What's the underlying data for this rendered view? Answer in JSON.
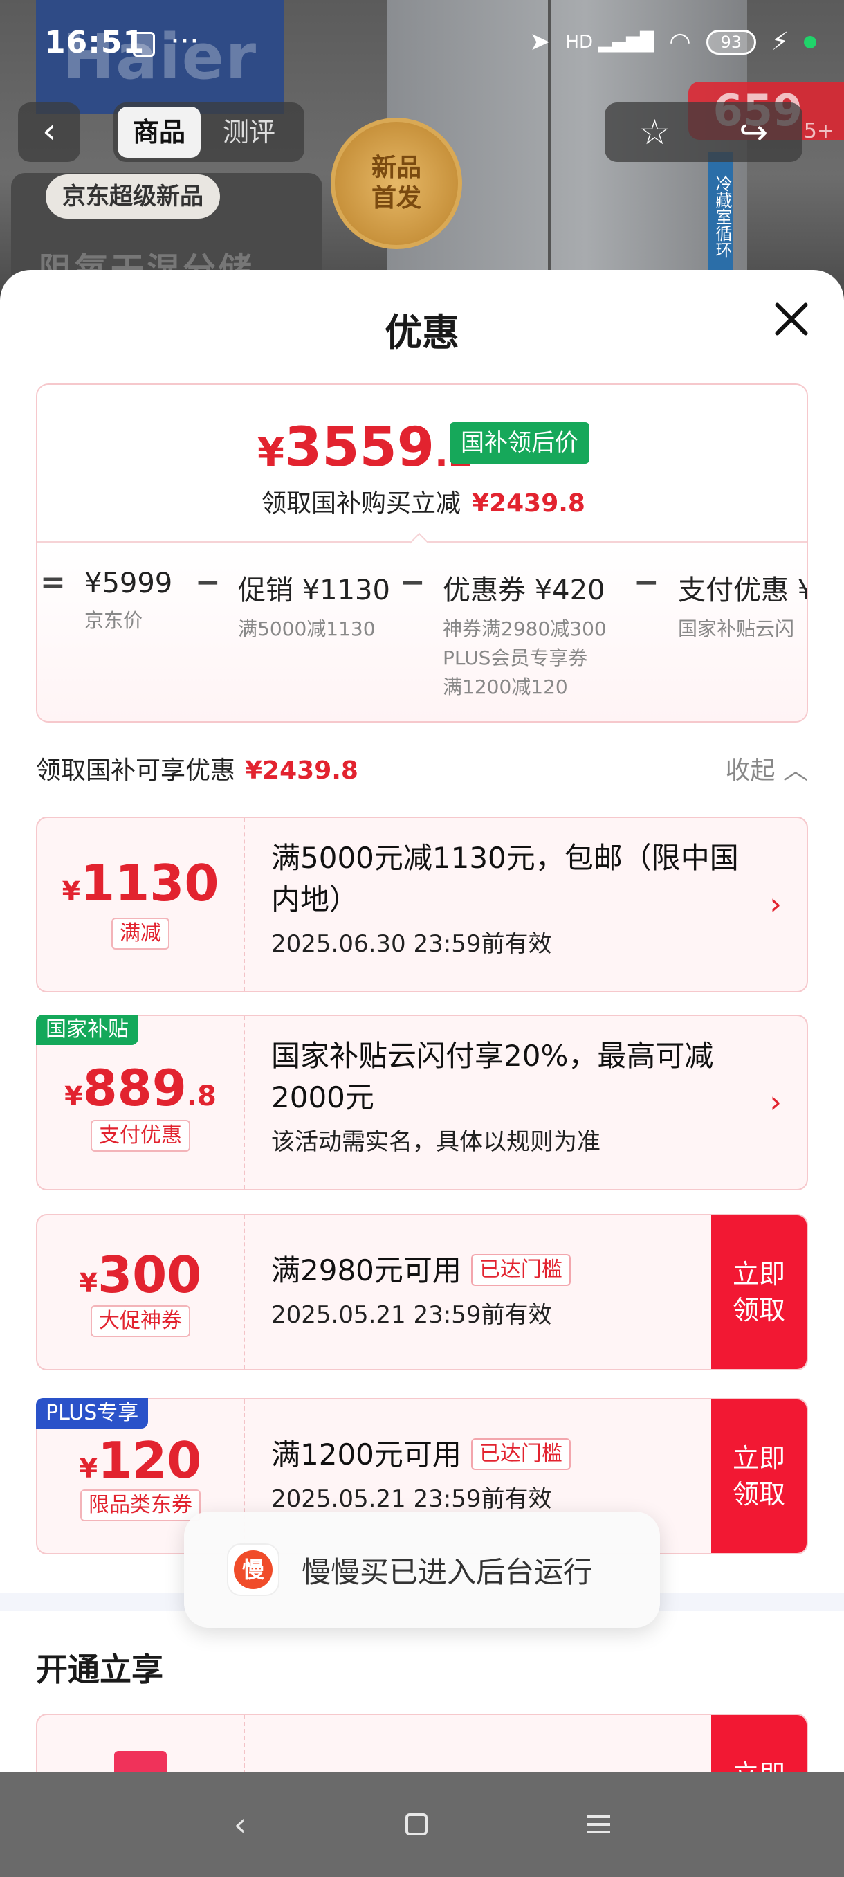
{
  "status_bar": {
    "time": "16:51",
    "more": "···",
    "network": "HD",
    "battery": "93"
  },
  "background_page": {
    "brand": "Haier",
    "nav_tabs": [
      "商品",
      "测评"
    ],
    "badge_line1": "新品",
    "badge_line2": "首发",
    "jd_tag": "京东超级新品",
    "headline": "阻氧干湿分储",
    "fridge_label": "冷藏室循环",
    "price_peek": "659",
    "price_peek_suffix": "5+"
  },
  "sheet": {
    "title": "优惠",
    "price": {
      "symbol": "¥",
      "integer": "3559",
      "decimal": ".2",
      "badge": "国补领后价",
      "subtitle": "领取国补购买立减",
      "savings": "¥2439.8"
    },
    "calc": {
      "equals": "=",
      "minus": "−",
      "items": [
        {
          "amount": "¥5999",
          "desc": "京东价"
        },
        {
          "amount": "促销 ¥1130",
          "desc": "满5000减1130"
        },
        {
          "amount": "优惠券 ¥420",
          "desc": "神券满2980减300",
          "desc2": "PLUS会员专享券",
          "desc3": "满1200减120"
        },
        {
          "amount": "支付优惠 ¥",
          "desc": "国家补贴云闪"
        }
      ]
    },
    "summary": {
      "label": "领取国补可享优惠",
      "value": "¥2439.8",
      "collapse": "收起"
    },
    "coupons": [
      {
        "symbol": "¥",
        "amount": "1130",
        "decimal": "",
        "type": "满减",
        "title": "满5000元减1130元，包邮（限中国内地）",
        "meta": "2025.06.30 23:59前有效"
      },
      {
        "tag": "国家补贴",
        "symbol": "¥",
        "amount": "889",
        "decimal": ".8",
        "type": "支付优惠",
        "title": "国家补贴云闪付享20%，最高可减2000元",
        "meta": "该活动需实名，具体以规则为准"
      },
      {
        "symbol": "¥",
        "amount": "300",
        "decimal": "",
        "type": "大促神券",
        "title": "满2980元可用",
        "reached": "已达门槛",
        "meta": "2025.05.21 23:59前有效",
        "claim": "立即领取"
      },
      {
        "tag": "PLUS专享",
        "symbol": "¥",
        "amount": "120",
        "decimal": "",
        "type": "限品类东券",
        "title": "满1200元可用",
        "reached": "已达门槛",
        "meta": "2025.05.21 23:59前有效",
        "claim": "立即领取"
      }
    ],
    "section_title": "开通立享",
    "partial_claim": "立即"
  },
  "toast": {
    "icon_text": "慢",
    "message": "慢慢买已进入后台运行"
  },
  "colors": {
    "accent_red": "#e2232f",
    "claim_red": "#f21833",
    "gov_green": "#16a85a",
    "plus_blue": "#2a52c9"
  }
}
